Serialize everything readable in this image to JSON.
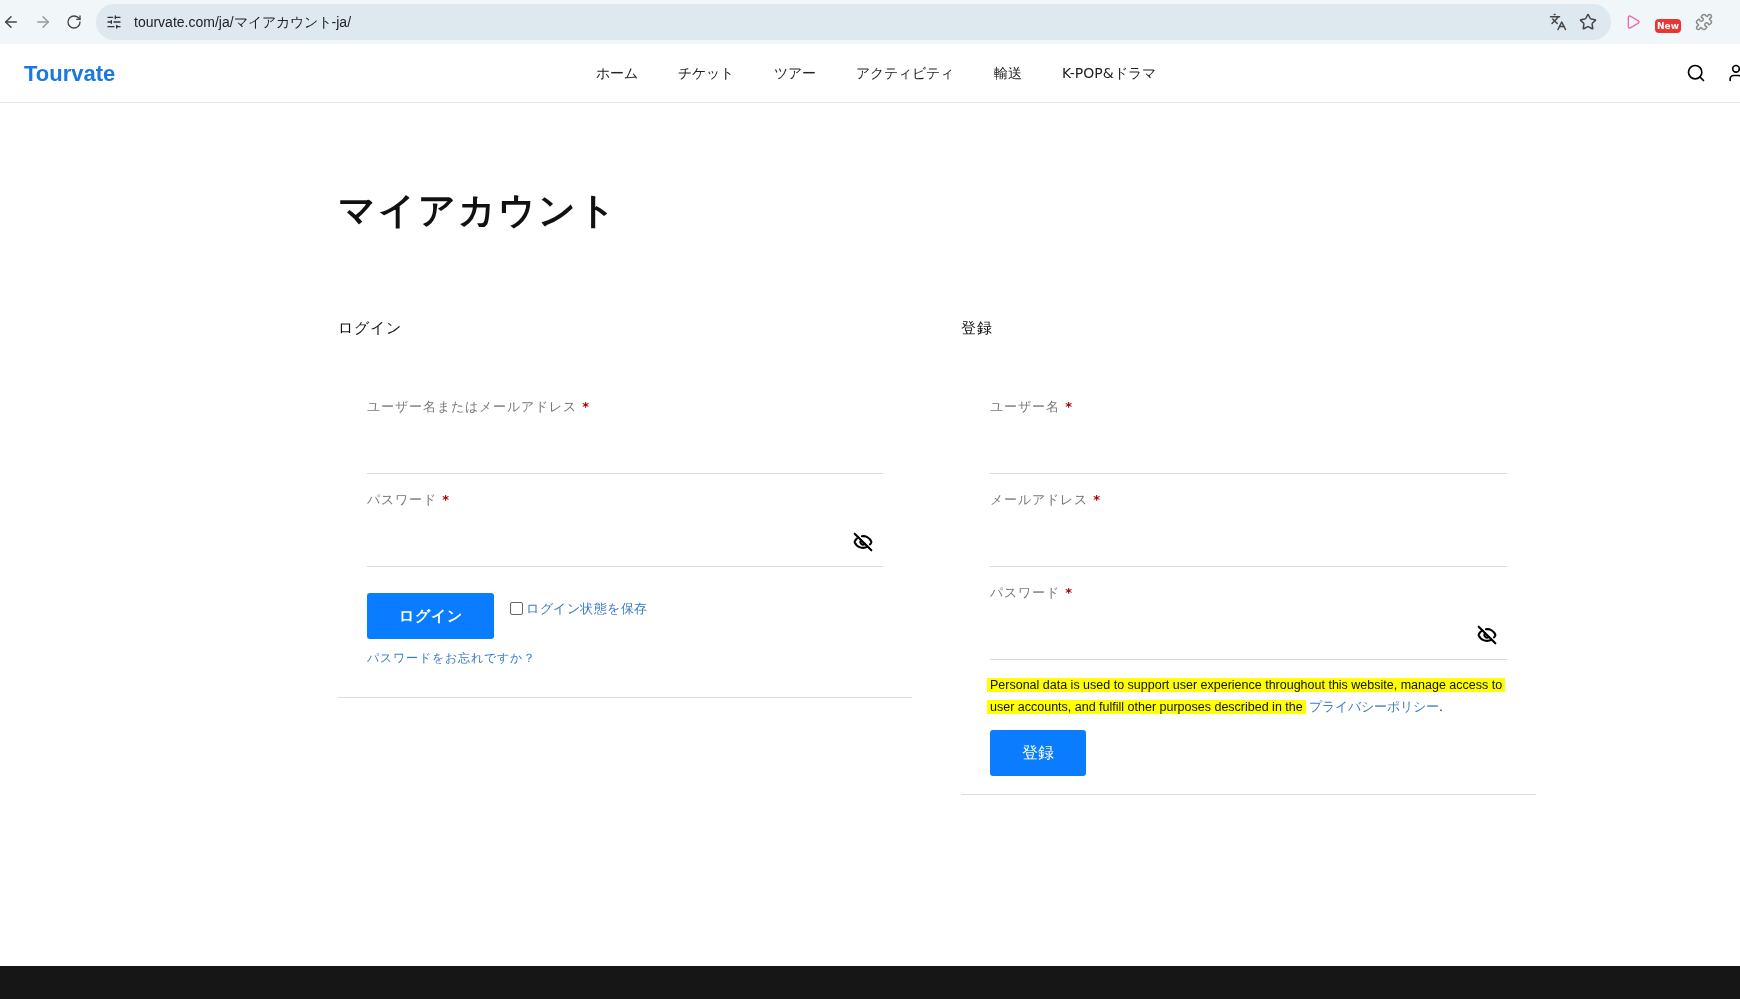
{
  "browser": {
    "url": "tourvate.com/ja/マイアカウント-ja/",
    "extension_badge": "New"
  },
  "site": {
    "logo": "Tourvate",
    "nav": [
      "ホーム",
      "チケット",
      "ツアー",
      "アクティビティ",
      "輸送",
      "K-POP&ドラマ"
    ]
  },
  "page_title": "マイアカウント",
  "login": {
    "heading": "ログイン",
    "fields": [
      {
        "label": "ユーザー名またはメールアドレス",
        "required_mark": "*",
        "kind": "text"
      },
      {
        "label": "パスワード",
        "required_mark": "*",
        "kind": "password"
      }
    ],
    "submit": "ログイン",
    "remember": {
      "label": "ログイン状態を保存",
      "checked": false
    },
    "forgot_link": "パスワードをお忘れですか？"
  },
  "register": {
    "heading": "登録",
    "fields": [
      {
        "label": "ユーザー名",
        "required_mark": "*",
        "kind": "text"
      },
      {
        "label": "メールアドレス",
        "required_mark": "*",
        "kind": "text"
      },
      {
        "label": "パスワード",
        "required_mark": "*",
        "kind": "password"
      }
    ],
    "privacy": {
      "text": "Personal data is used to support user experience throughout this website, manage access to user accounts, and fulfill other purposes described in the",
      "link": "プライバシーポリシー",
      "end": "."
    },
    "submit": "登録"
  }
}
